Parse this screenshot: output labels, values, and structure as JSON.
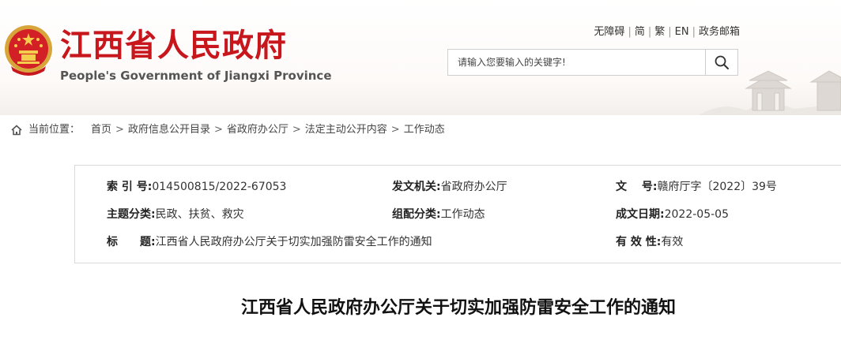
{
  "header": {
    "title": "江西省人民政府",
    "subtitle": "People's Government of Jiangxi Province",
    "emblem_icon": "national-emblem-icon",
    "brand_color": "#c8161d"
  },
  "toplinks": {
    "accessibility": "无障碍",
    "simplified": "简",
    "traditional": "繁",
    "english": "EN",
    "mail": "政务邮箱",
    "separator": "|"
  },
  "search": {
    "placeholder": "请输入您要输入的关键字!",
    "button_icon": "search-icon"
  },
  "breadcrumb": {
    "label": "当前位置：",
    "icon": "home-icon",
    "items": [
      "首页",
      "政府信息公开目录",
      "省政府办公厅",
      "法定主动公开内容",
      "工作动态"
    ],
    "separator": ">"
  },
  "meta": {
    "index_key": "索 引 号:",
    "index_val": "014500815/2022-67053",
    "issuer_key": "发文机关:",
    "issuer_val": "省政府办公厅",
    "docno_key": "文　 号:",
    "docno_val": "赣府厅字〔2022〕39号",
    "topic_key": "主题分类:",
    "topic_val": "民政、扶贫、救灾",
    "group_key": "组配分类:",
    "group_val": "工作动态",
    "date_key": "成文日期:",
    "date_val": "2022-05-05",
    "title_key": "标　　题:",
    "title_val": "江西省人民政府办公厅关于切实加强防雷安全工作的通知",
    "valid_key": "有 效 性:",
    "valid_val": "有效"
  },
  "document": {
    "title": "江西省人民政府办公厅关于切实加强防雷安全工作的通知"
  }
}
